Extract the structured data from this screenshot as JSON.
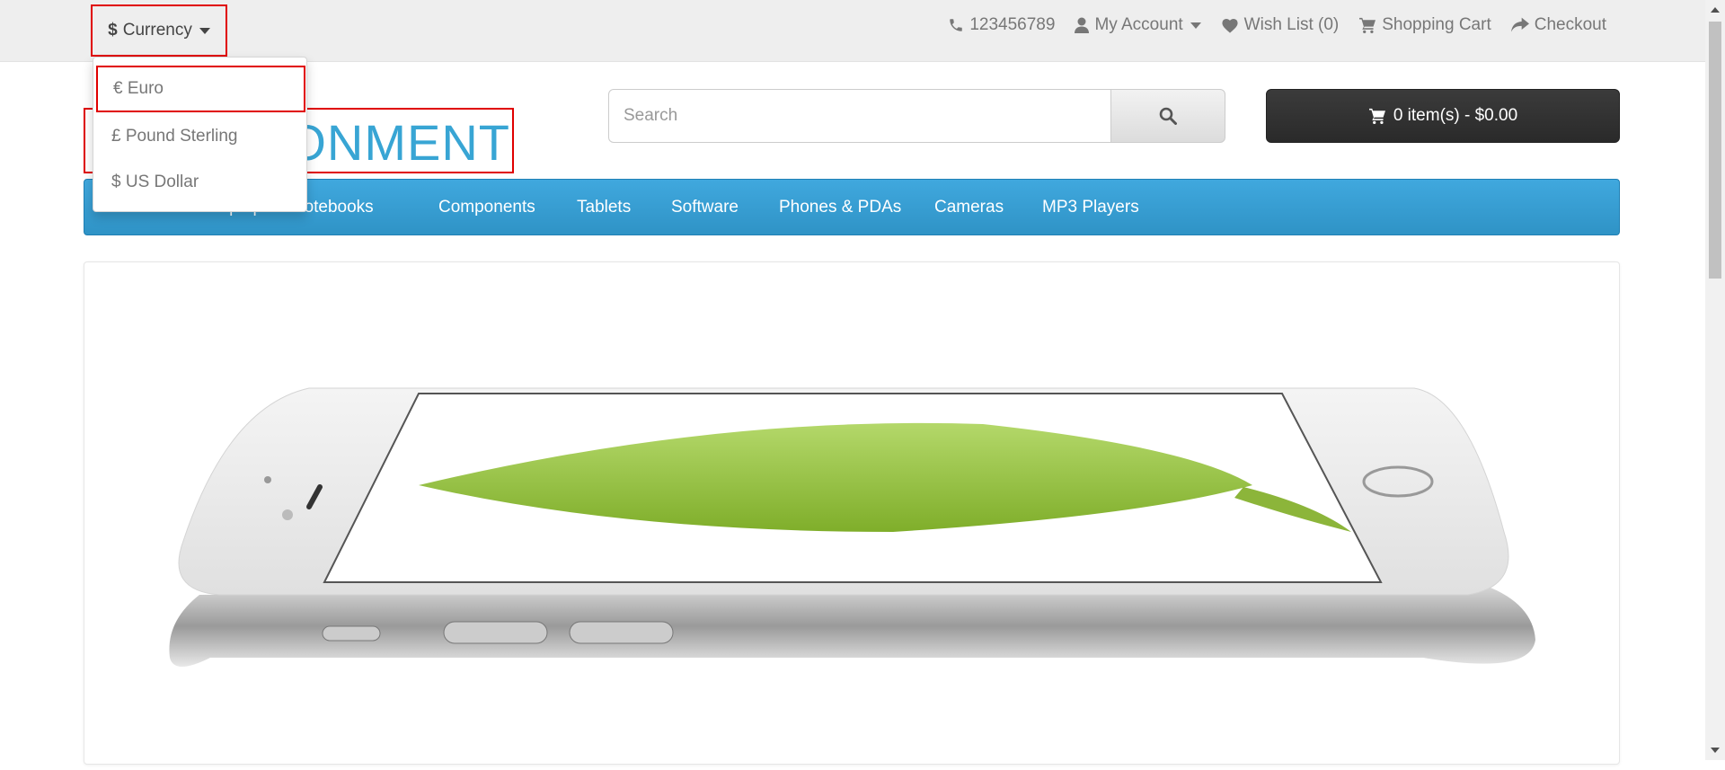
{
  "topbar": {
    "currency_symbol": "$",
    "currency_label": "Currency",
    "phone": "123456789",
    "my_account": "My Account",
    "wish_list": "Wish List (0)",
    "shopping_cart": "Shopping Cart",
    "checkout": "Checkout"
  },
  "currency_menu": {
    "items": [
      {
        "label": "€ Euro"
      },
      {
        "label": "£ Pound Sterling"
      },
      {
        "label": "$ US Dollar"
      }
    ]
  },
  "header": {
    "logo_text": "RONMENT",
    "search_placeholder": "Search",
    "cart_label": "0 item(s) - $0.00"
  },
  "nav": {
    "items": [
      {
        "label": "Laptops & Notebooks"
      },
      {
        "label": "Components"
      },
      {
        "label": "Tablets"
      },
      {
        "label": "Software"
      },
      {
        "label": "Phones & PDAs"
      },
      {
        "label": "Cameras"
      },
      {
        "label": "MP3 Players"
      }
    ]
  },
  "colors": {
    "accent": "#38a5d4",
    "nav_bg": "#3a9fd6",
    "highlight": "#e00000",
    "cart_bg": "#333333"
  }
}
